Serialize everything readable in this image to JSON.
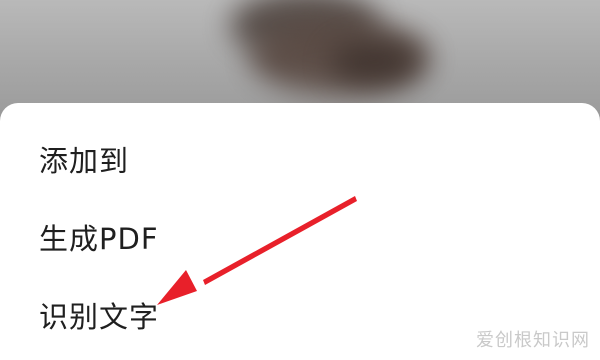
{
  "menu": {
    "items": [
      {
        "label": "添加到"
      },
      {
        "label": "生成PDF"
      },
      {
        "label": "识别文字"
      }
    ]
  },
  "annotation": {
    "arrow_color": "#e8202a",
    "points_to": "识别文字"
  },
  "watermark": {
    "text": "爱创根知识网"
  }
}
